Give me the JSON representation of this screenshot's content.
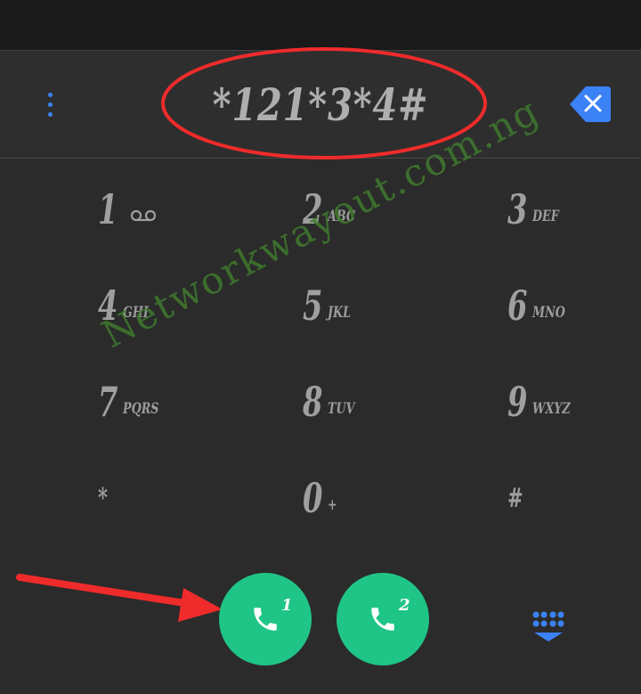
{
  "dialer": {
    "number": "*121*3*4#",
    "keys": [
      {
        "digit": "1",
        "letters": "",
        "icon": "voicemail-icon"
      },
      {
        "digit": "2",
        "letters": "ABC"
      },
      {
        "digit": "3",
        "letters": "DEF"
      },
      {
        "digit": "4",
        "letters": "GHI"
      },
      {
        "digit": "5",
        "letters": "JKL"
      },
      {
        "digit": "6",
        "letters": "MNO"
      },
      {
        "digit": "7",
        "letters": "PQRS"
      },
      {
        "digit": "8",
        "letters": "TUV"
      },
      {
        "digit": "9",
        "letters": "WXYZ"
      },
      {
        "digit": "*",
        "letters": ""
      },
      {
        "digit": "0",
        "letters": "+"
      },
      {
        "digit": "#",
        "letters": ""
      }
    ]
  },
  "calls": {
    "sim1_label": "1",
    "sim2_label": "2"
  },
  "watermark": "Networkwayout.com.ng",
  "colors": {
    "accent": "#3b82f6",
    "call_green": "#1fc586",
    "annotation_red": "#ef2b2b"
  }
}
